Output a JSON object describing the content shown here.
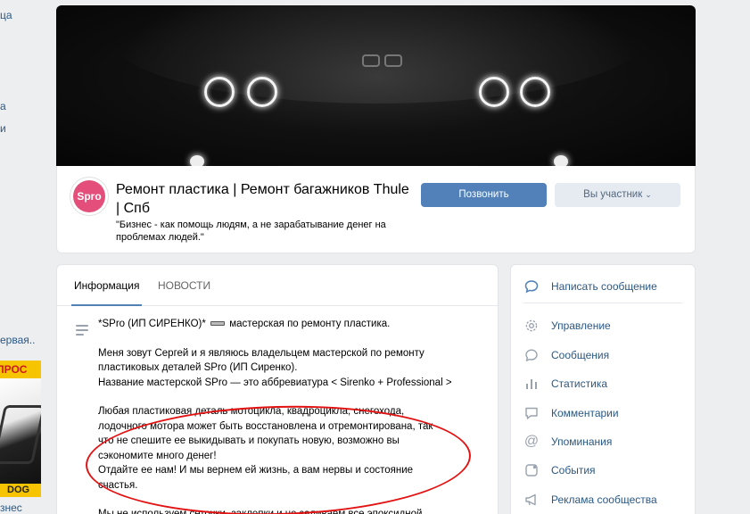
{
  "left_sidebar": {
    "fragments": [
      "ца",
      "a",
      "и",
      "ервая..",
      "знес"
    ],
    "ad": {
      "top_text": "ПРОС",
      "bottom_text": "DOG"
    }
  },
  "group": {
    "title": "Ремонт пластика | Ремонт багажников Thule | Спб",
    "status": "\"Бизнес - как помощь людям, а не зарабатывание денег на проблемах людей.\"",
    "avatar_text": "Spro"
  },
  "actions": {
    "call_label": "Позвонить",
    "member_label": "Вы участник"
  },
  "tabs": [
    {
      "label": "Информация",
      "active": true
    },
    {
      "label": "НОВОСТИ",
      "active": false
    }
  ],
  "description": {
    "line1_a": "*SPro (ИП СИРЕНКО)*",
    "line1_b": "мастерская по ремонту пластика.",
    "para2": [
      "Меня зовут Сергей и я являюсь владельцем мастерской по ремонту",
      "пластиковых деталей SPro (ИП Сиренко).",
      "Название мастерской SPro — это аббревиатура < Sirenko + Professional >"
    ],
    "para3": [
      "Любая пластиковая деталь мотоцикла, квадроцикла, снегохода,",
      "лодочного мотора может быть восстановлена и отремонтирована, так",
      "что не спешите ее выкидывать и покупать новую, возможно вы",
      "сэкономите много денег!",
      "Отдайте ее нам! И мы вернем ей жизнь, а вам нервы и состояние",
      "счастья."
    ],
    "para4": "Мы не используем сеточки, заклепки и не заливаем все эпоксидной"
  },
  "side_menu": [
    {
      "label": "Написать сообщение",
      "icon": "message-bubble-icon"
    },
    {
      "label": "Управление",
      "icon": "gear-icon"
    },
    {
      "label": "Сообщения",
      "icon": "chat-icon"
    },
    {
      "label": "Статистика",
      "icon": "bar-chart-icon"
    },
    {
      "label": "Комментарии",
      "icon": "comment-icon"
    },
    {
      "label": "Упоминания",
      "icon": "at-sign-icon"
    },
    {
      "label": "События",
      "icon": "event-icon"
    },
    {
      "label": "Реклама сообщества",
      "icon": "megaphone-icon"
    }
  ],
  "colors": {
    "accent": "#5181b8",
    "link": "#2a5885",
    "annotation": "#e21212",
    "background": "#edeef0"
  }
}
